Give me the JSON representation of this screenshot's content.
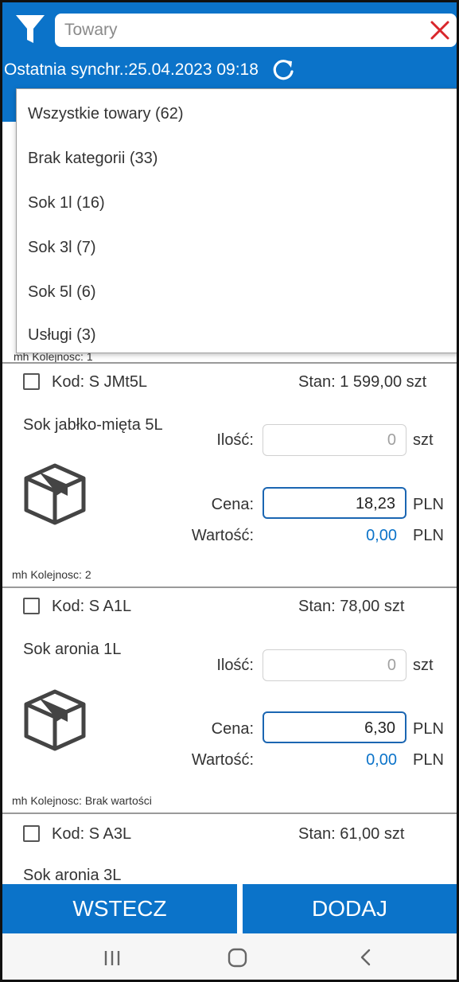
{
  "header": {
    "search_placeholder": "Towary",
    "sync_label": "Ostatnia synchr.:25.04.2023 09:18"
  },
  "dropdown": {
    "items": [
      "Wszystkie towary (62)",
      "Brak kategorii (33)",
      "Sok 1l (16)",
      "Sok 3l (7)",
      "Sok 5l (6)",
      "Usługi (3)"
    ]
  },
  "list": {
    "partial_label_top": "mh Kolejnosc: 1",
    "products": [
      {
        "kod": "Kod: S JMt5L",
        "stan": "Stan: 1 599,00 szt",
        "name": "Sok jabłko-mięta 5L",
        "ilosc_label": "Ilość:",
        "ilosc_value": "0",
        "ilosc_unit": "szt",
        "cena_label": "Cena:",
        "cena_value": "18,23",
        "cena_unit": "PLN",
        "wartosc_label": "Wartość:",
        "wartosc_value": "0,00",
        "wartosc_unit": "PLN",
        "footer_label": "mh Kolejnosc: 2"
      },
      {
        "kod": "Kod: S A1L",
        "stan": "Stan: 78,00 szt",
        "name": "Sok aronia 1L",
        "ilosc_label": "Ilość:",
        "ilosc_value": "0",
        "ilosc_unit": "szt",
        "cena_label": "Cena:",
        "cena_value": "6,30",
        "cena_unit": "PLN",
        "wartosc_label": "Wartość:",
        "wartosc_value": "0,00",
        "wartosc_unit": "PLN",
        "footer_label": "mh Kolejnosc: Brak wartości"
      },
      {
        "kod": "Kod: S A3L",
        "stan": "Stan: 61,00 szt",
        "name": "Sok aronia 3L"
      }
    ]
  },
  "buttons": {
    "back": "WSTECZ",
    "add": "DODAJ"
  },
  "icons": {
    "filter": "filter-icon",
    "clear": "close-icon",
    "refresh": "refresh-icon",
    "product": "box-icon",
    "nav_recents": "recents-icon",
    "nav_home": "home-icon",
    "nav_back": "back-icon"
  },
  "colors": {
    "accent": "#0b73c9",
    "clear_icon": "#d9262b",
    "value_text": "#0b73c9"
  }
}
